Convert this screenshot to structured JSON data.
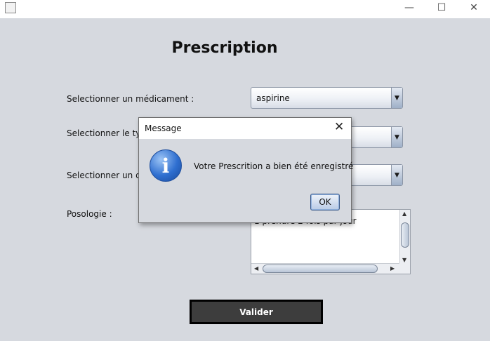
{
  "window": {
    "minimize_glyph": "—",
    "maximize_glyph": "☐",
    "close_glyph": "✕",
    "icons": [
      "java-app-icon",
      "minimize-icon",
      "maximize-icon",
      "close-icon"
    ]
  },
  "form": {
    "title": "Prescription",
    "medicament_label": "Selectionner un médicament :",
    "medicament_value": "aspirine",
    "type_label": "Selectionner le type",
    "type_value": "",
    "dosage_label": "Selectionner un do",
    "dosage_value": "",
    "posologie_label": "Posologie :",
    "posologie_value": "1 prendre 2 fois par jour",
    "submit_label": "Valider"
  },
  "dialog": {
    "title": "Message",
    "close_glyph": "✕",
    "icon": "information-icon",
    "icon_glyph": "i",
    "message": "Votre Prescrition a bien été enregistré",
    "ok_label": "OK"
  },
  "colors": {
    "background": "#d6d9df",
    "submit_button": "#3d3d3d",
    "info_icon": "#2f6fd0"
  }
}
